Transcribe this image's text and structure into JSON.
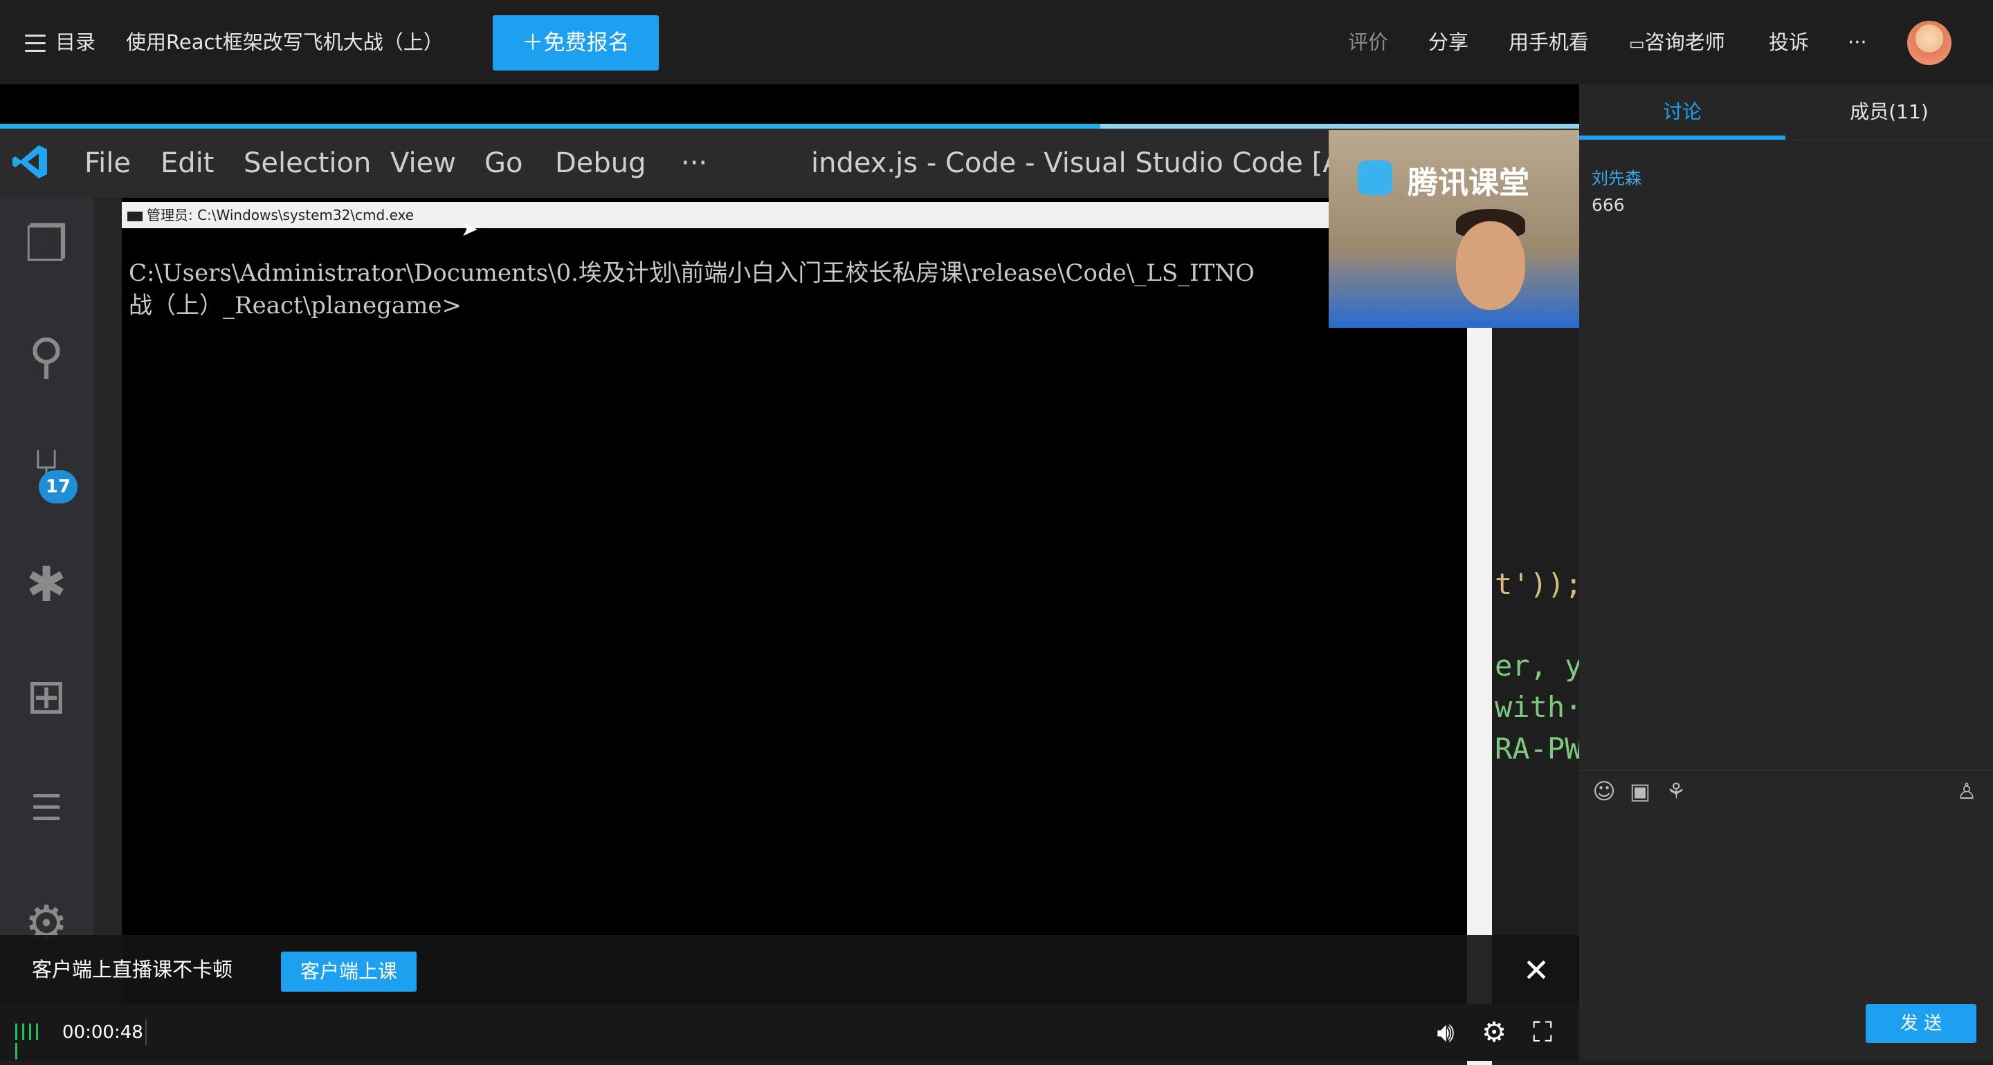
{
  "header": {
    "catalog_label": "目录",
    "course_title": "使用React框架改写飞机大战（上）",
    "signup_label": "免费报名",
    "rate_label": "评价",
    "share_label": "分享",
    "mobile_label": "用手机看",
    "consult_label": "咨询老师",
    "report_label": "投诉",
    "more_label": "···"
  },
  "vscode": {
    "menu": [
      "File",
      "Edit",
      "Selection",
      "View",
      "Go",
      "Debug",
      "···"
    ],
    "window_title": "index.js - Code - Visual Studio Code [Ad...",
    "scm_badge": "17",
    "code_lines": [
      "t'));",
      "er, y",
      "with·",
      "RA-PW"
    ]
  },
  "cmd": {
    "title": "管理员: C:\\Windows\\system32\\cmd.exe",
    "line1": "C:\\Users\\Administrator\\Documents\\0.埃及计划\\前端小白入门王校长私房课\\release\\Code\\_LS_ITNO",
    "line2": "战（上）_React\\planegame>"
  },
  "pip": {
    "logo_text": "腾讯课堂"
  },
  "banner": {
    "text": "客户端上直播课不卡顿",
    "button": "客户端上课",
    "close": "✕"
  },
  "player": {
    "time": "00:00:48"
  },
  "panel": {
    "tabs": [
      "讨论",
      "成员(11)"
    ],
    "messages": [
      {
        "user": "刘先森",
        "text": "666"
      }
    ],
    "send_label": "发 送"
  },
  "colors": {
    "accent": "#1ea0f0",
    "vscode_blue": "#23aee6"
  }
}
